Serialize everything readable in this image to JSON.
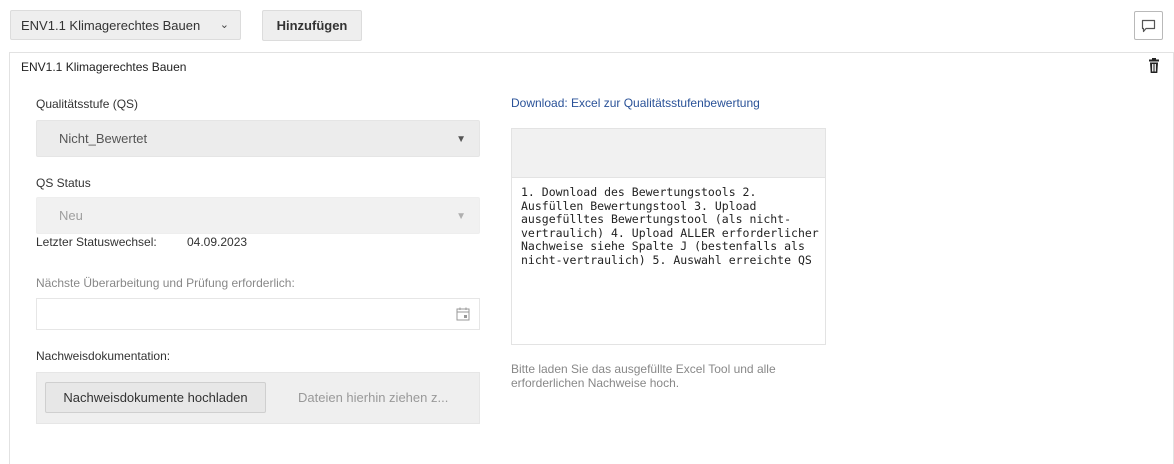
{
  "toolbar": {
    "criterion_select_value": "ENV1.1 Klimagerechtes Bauen",
    "add_button_label": "Hinzufügen",
    "comment_icon": "comment-icon"
  },
  "panel": {
    "title": "ENV1.1 Klimagerechtes Bauen",
    "delete_icon": "trash-icon",
    "quality_level": {
      "label": "Qualitätsstufe (QS)",
      "value": "Nicht_Bewertet"
    },
    "qs_status": {
      "label": "QS Status",
      "value": "Neu"
    },
    "last_status_change": {
      "label": "Letzter Statuswechsel:",
      "value": "04.09.2023"
    },
    "next_review": {
      "label": "Nächste Überarbeitung und Prüfung erforderlich:",
      "value": "",
      "icon": "calendar-icon"
    },
    "documentation": {
      "label": "Nachweisdokumentation:",
      "upload_button_label": "Nachweisdokumente hochladen",
      "drop_text": "Dateien hierhin ziehen z..."
    },
    "download_link": "Download: Excel zur Qualitätsstufenbewertung",
    "instructions": "1. Download des Bewertungstools 2. Ausfüllen Bewertungstool 3. Upload ausgefülltes Bewertungstool (als nicht-vertraulich) 4. Upload ALLER erforderlicher Nachweise siehe Spalte J (bestenfalls als nicht-vertraulich) 5. Auswahl erreichte QS",
    "hint": "Bitte laden Sie das ausgefüllte Excel Tool und alle erforderlichen Nachweise hoch."
  }
}
